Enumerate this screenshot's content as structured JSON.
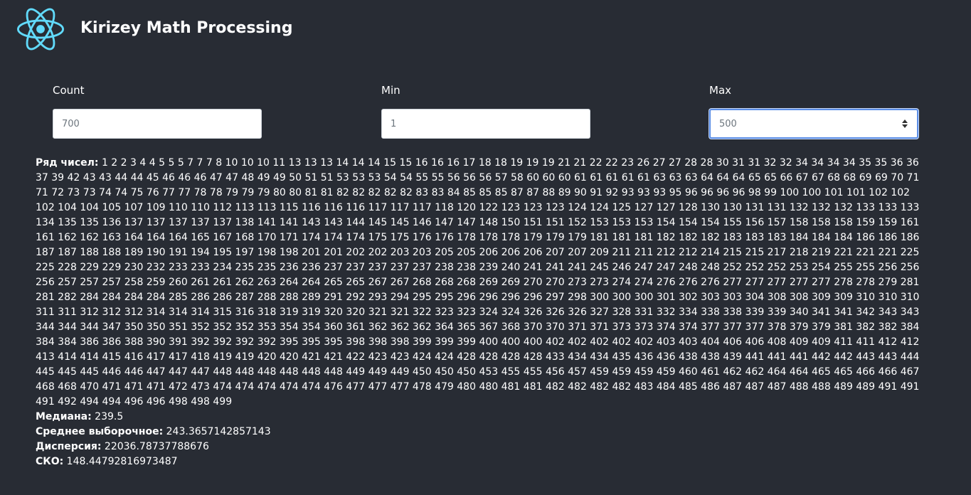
{
  "header": {
    "title": "Kirizey Math Processing",
    "logo_icon": "react-atom-icon",
    "logo_color": "#61dafb"
  },
  "form": {
    "count": {
      "label": "Count",
      "value": "700"
    },
    "min": {
      "label": "Min",
      "value": "1"
    },
    "max": {
      "label": "Max",
      "value": "500"
    }
  },
  "results": {
    "series_label": "Ряд чисел:",
    "series": "1 2 2 3 4 4 5 5 5 7 7 7 8 10 10 10 11 13 13 13 14 14 14 15 15 16 16 16 17 18 18 19 19 19 21 21 22 22 23 26 27 27 28 28 30 31 31 32 32 34 34 34 34 35 35 36 36 37 39 42 43 43 44 44 45 46 46 46 47 47 48 49 49 50 51 51 53 53 53 54 54 55 55 56 56 56 57 58 60 60 60 61 61 61 61 61 63 63 63 64 64 64 65 65 66 67 67 68 68 69 69 70 71 71 72 73 73 74 74 75 76 77 77 78 78 79 79 79 80 80 81 81 82 82 82 82 82 83 83 84 85 85 85 87 87 88 89 90 91 92 93 93 93 95 96 96 96 96 98 99 100 100 101 101 102 102 102 104 104 105 107 109 110 110 112 113 113 115 116 116 116 117 117 117 118 120 122 123 123 123 124 124 125 127 127 128 130 130 131 131 132 132 132 133 133 133 134 135 135 136 137 137 137 137 137 138 141 141 143 143 144 145 145 146 147 147 148 150 151 151 152 153 153 153 154 154 154 155 156 157 158 158 158 159 159 161 161 162 162 163 164 164 164 165 167 168 170 171 174 174 174 175 175 176 176 178 178 178 179 179 179 181 181 181 182 182 182 183 183 183 184 184 184 186 186 186 187 187 188 188 189 190 191 194 195 197 198 198 201 201 202 202 203 203 205 205 206 206 206 207 207 209 211 211 212 212 214 215 215 217 218 219 221 221 221 225 225 228 229 229 230 232 233 233 234 235 235 236 236 237 237 237 237 237 238 238 239 240 241 241 241 245 246 247 247 248 248 252 252 252 253 254 255 255 256 256 256 257 257 257 258 259 260 261 261 262 263 264 264 265 265 267 267 268 268 268 269 269 270 270 273 273 274 274 276 276 276 277 277 277 277 277 278 278 279 281 281 282 284 284 284 284 285 286 286 287 288 288 289 291 292 293 294 295 295 296 296 296 296 297 298 300 300 300 301 302 303 303 304 308 308 309 309 310 310 310 311 311 312 312 312 314 314 314 315 316 318 319 319 320 320 321 321 322 323 323 324 324 326 326 326 327 328 331 332 334 338 338 339 339 340 341 341 342 343 343 344 344 344 347 350 350 351 352 352 352 353 354 354 360 361 362 362 362 364 365 367 368 370 370 371 371 373 373 374 374 377 377 377 378 379 379 381 382 382 384 384 384 386 386 388 390 391 392 392 392 392 395 395 395 398 398 398 399 399 399 400 400 400 402 402 402 402 402 403 403 404 406 406 408 409 409 411 411 412 412 413 414 414 415 416 417 417 418 419 419 420 420 421 421 422 423 423 424 424 428 428 428 428 433 434 434 435 436 436 438 438 439 441 441 441 442 442 443 443 444 445 445 445 446 446 447 447 447 448 448 448 448 448 448 449 449 449 450 450 450 453 455 455 456 457 459 459 459 459 460 461 462 462 464 464 465 465 466 466 467 468 468 470 471 471 471 472 473 474 474 474 474 474 476 477 477 477 478 479 480 480 481 481 482 482 482 482 483 484 485 486 487 487 487 488 488 489 489 491 491 491 492 494 494 496 496 498 498 499",
    "median_label": "Медиана:",
    "median": "239.5",
    "mean_label": "Среднее выборочное:",
    "mean": "243.3657142857143",
    "variance_label": "Дисперсия:",
    "variance": "22036.78737788676",
    "std_label": "СКО:",
    "std": "148.44792816973487"
  }
}
